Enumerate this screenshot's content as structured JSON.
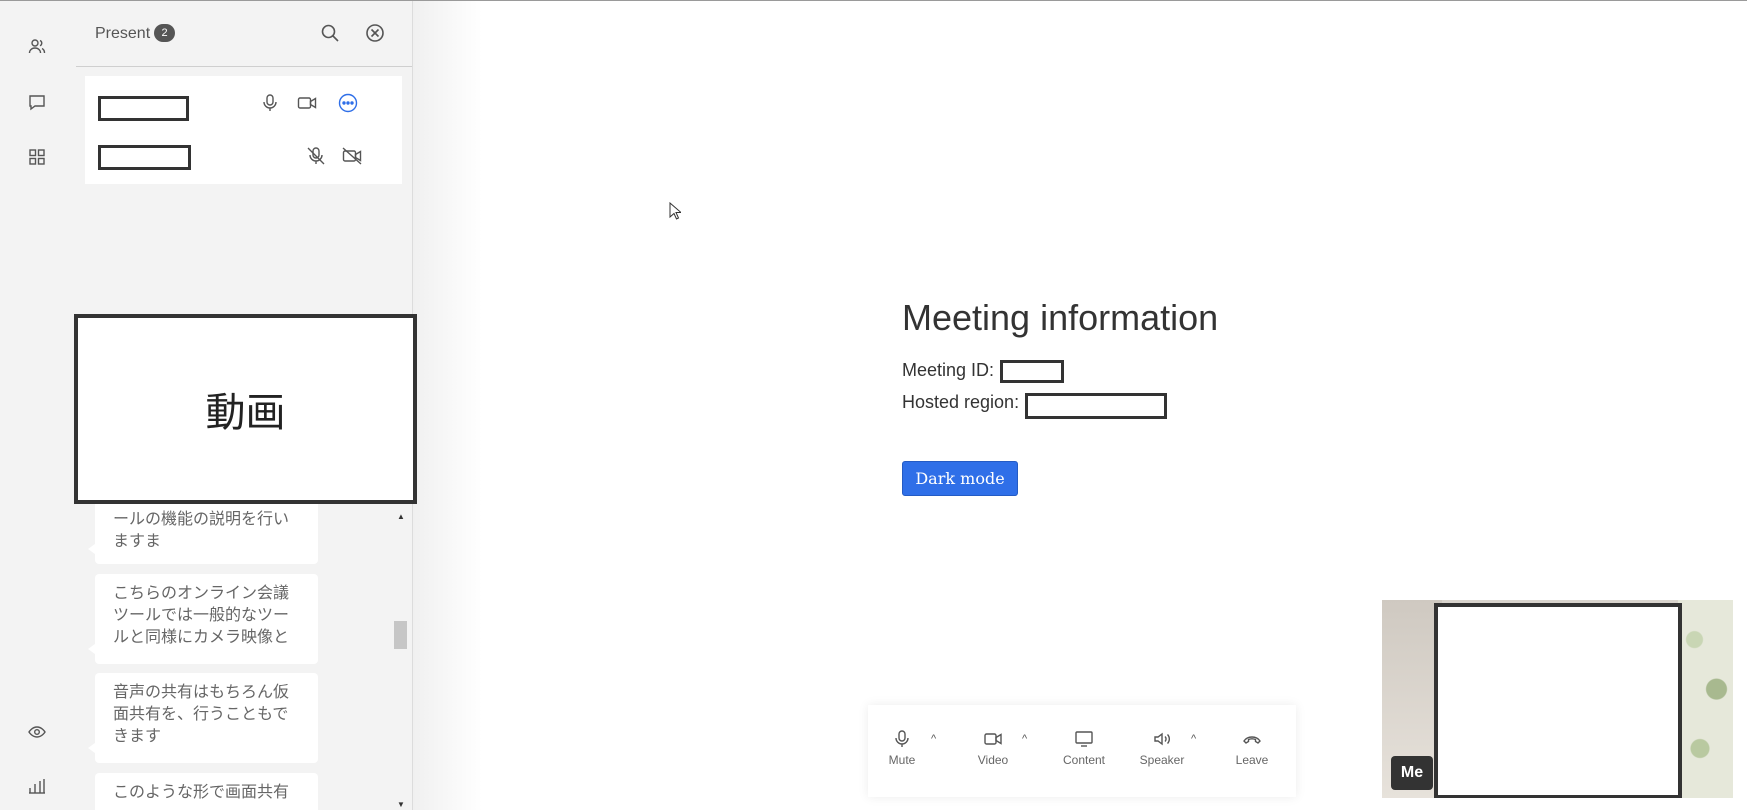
{
  "rail": {
    "items": [
      {
        "name": "participants",
        "icon": "people-icon"
      },
      {
        "name": "chat",
        "icon": "chat-bubble-icon"
      },
      {
        "name": "apps",
        "icon": "grid-icon"
      }
    ],
    "bottom": [
      {
        "name": "view",
        "icon": "eye-icon"
      },
      {
        "name": "stats",
        "icon": "bar-chart-icon"
      }
    ]
  },
  "panel": {
    "title": "Present",
    "count": "2",
    "participants": [
      {
        "mic": "on",
        "video": "on",
        "more": true
      },
      {
        "mic": "muted",
        "video": "off",
        "more": false
      }
    ]
  },
  "video_overlay": {
    "label": "動画"
  },
  "chat": {
    "messages": [
      "ールの機能の説明を行いますま",
      "こちらのオンライン会議ツールでは一般的なツールと同様にカメラ映像と",
      "音声の共有はもちろん仮面共有を、行うこともできます",
      "このような形で画面共有"
    ]
  },
  "meeting": {
    "title": "Meeting information",
    "id_label": "Meeting ID:",
    "region_label": "Hosted region:",
    "dark_mode_label": "Dark mode"
  },
  "toolbar": {
    "mute": "Mute",
    "video": "Video",
    "content": "Content",
    "speaker": "Speaker",
    "leave": "Leave"
  },
  "self_view": {
    "badge": "Me"
  },
  "colors": {
    "accent": "#2f6fe8",
    "panel_bg": "#f3f3f3",
    "badge": "#555555"
  }
}
